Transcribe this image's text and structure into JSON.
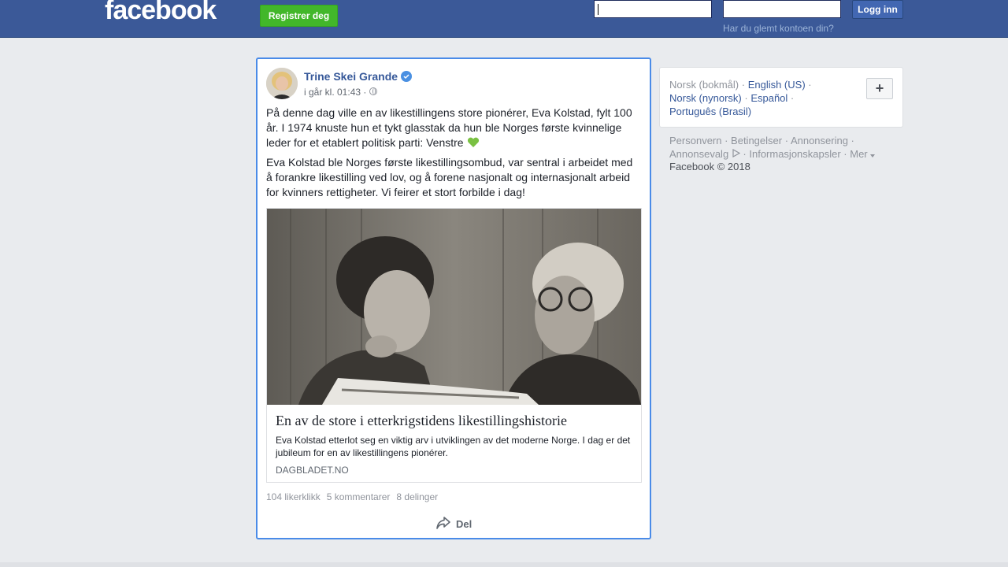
{
  "header": {
    "logo": "facebook",
    "register_label": "Registrer deg",
    "login_label": "Logg inn",
    "forgot_label": "Har du glemt kontoen din?"
  },
  "post": {
    "author": "Trine Skei Grande",
    "meta": "i går kl. 01:43 ·",
    "paragraph1": "På denne dag ville en av likestillingens store pionérer, Eva Kolstad, fylt 100 år. I 1974 knuste hun et tykt glasstak da hun ble Norges første kvinnelige leder for et etablert politisk parti: Venstre",
    "paragraph2": "Eva Kolstad ble Norges første likestillingsombud, var sentral i arbeidet med å forankre likestilling ved lov, og å forene nasjonalt og internasjonalt arbeid for kvinners rettigheter. Vi feirer et stort forbilde i dag!",
    "link": {
      "title": "En av de store i etterkrigstidens likestillingshistorie",
      "description": "Eva Kolstad etterlot seg en viktig arv i utviklingen av det moderne Norge. I dag er det jubileum for en av likestillingens pionérer.",
      "domain": "DAGBLADET.NO"
    },
    "stats": {
      "likes": "104 likerklikk",
      "comments": "5 kommentarer",
      "shares": "8 delinger"
    },
    "share_label": "Del"
  },
  "languages": {
    "current": "Norsk (bokmål)",
    "items": [
      "English (US)",
      "Norsk (nynorsk)",
      "Español",
      "Português (Brasil)"
    ],
    "more": "+"
  },
  "footer": {
    "links": [
      "Personvern",
      "Betingelser",
      "Annonsering",
      "Annonsevalg",
      "Informasjonskapsler",
      "Mer"
    ],
    "copyright": "Facebook © 2018"
  },
  "colors": {
    "brand": "#3b5998",
    "register": "#42b72a",
    "link": "#365899",
    "focus": "#4a8be8"
  }
}
